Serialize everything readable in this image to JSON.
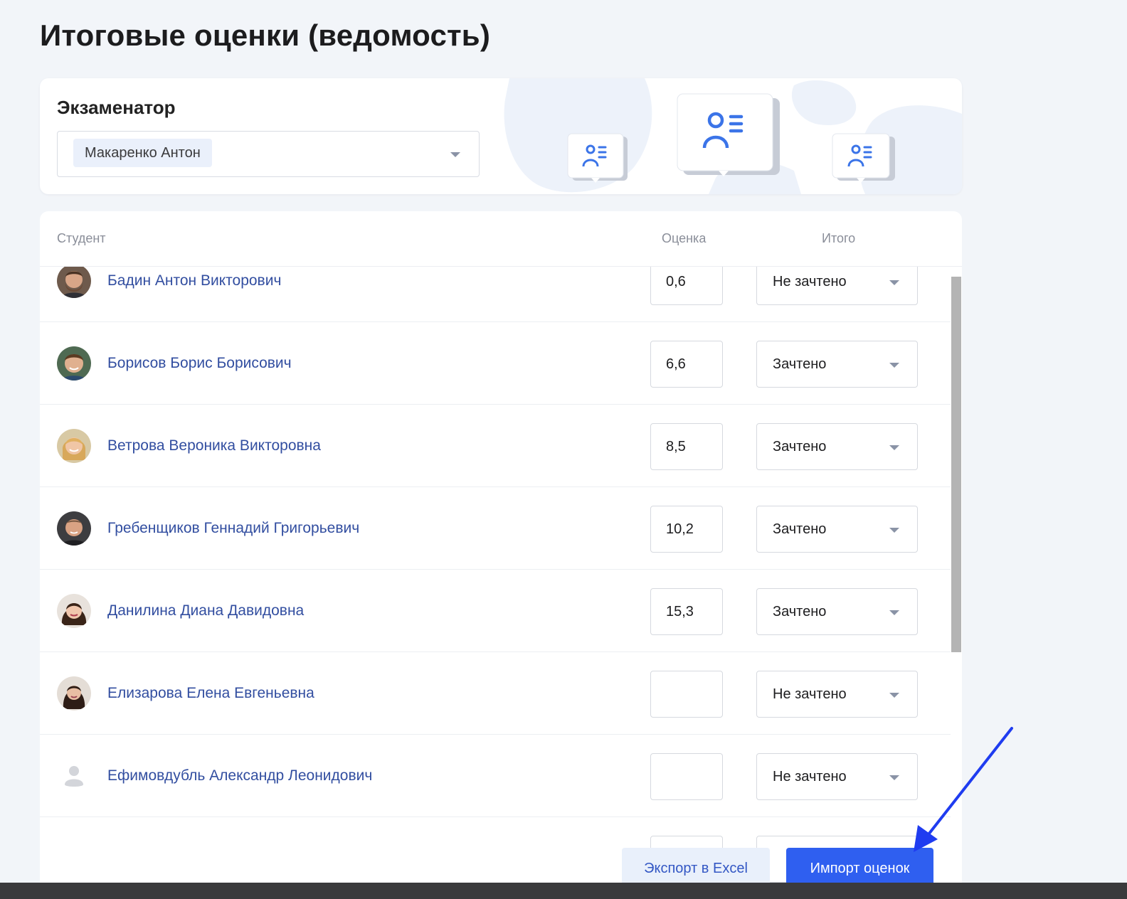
{
  "page": {
    "title": "Итоговые оценки (ведомость)"
  },
  "examiner": {
    "label": "Экзаменатор",
    "selected": "Макаренко Антон"
  },
  "table": {
    "headers": {
      "student": "Студент",
      "grade": "Оценка",
      "total": "Итого"
    },
    "rows": [
      {
        "name": "Бадин Антон Викторович",
        "grade": "0,6",
        "total": "Не зачтено",
        "avatar": "photo-male-beard"
      },
      {
        "name": "Борисов Борис Борисович",
        "grade": "6,6",
        "total": "Зачтено",
        "avatar": "photo-male-young"
      },
      {
        "name": "Ветрова Вероника Викторовна",
        "grade": "8,5",
        "total": "Зачтено",
        "avatar": "photo-female-blonde"
      },
      {
        "name": "Гребенщиков Геннадий Григорьевич",
        "grade": "10,2",
        "total": "Зачтено",
        "avatar": "photo-male-bald"
      },
      {
        "name": "Данилина Диана Давидовна",
        "grade": "15,3",
        "total": "Зачтено",
        "avatar": "photo-female-dark"
      },
      {
        "name": "Елизарова Елена Евгеньевна",
        "grade": "",
        "total": "Не зачтено",
        "avatar": "photo-female-brunette"
      },
      {
        "name": "Ефимовдубль Александр Леонидович",
        "grade": "",
        "total": "Не зачтено",
        "avatar": "user-placeholder-icon"
      },
      {
        "name": "",
        "grade": "",
        "total": "",
        "avatar": ""
      }
    ]
  },
  "actions": {
    "export_label": "Экспорт в Excel",
    "import_label": "Импорт оценок"
  },
  "colors": {
    "accent": "#2f5ff0",
    "link": "#324ea0",
    "annotation_arrow": "#1f3cf0"
  }
}
